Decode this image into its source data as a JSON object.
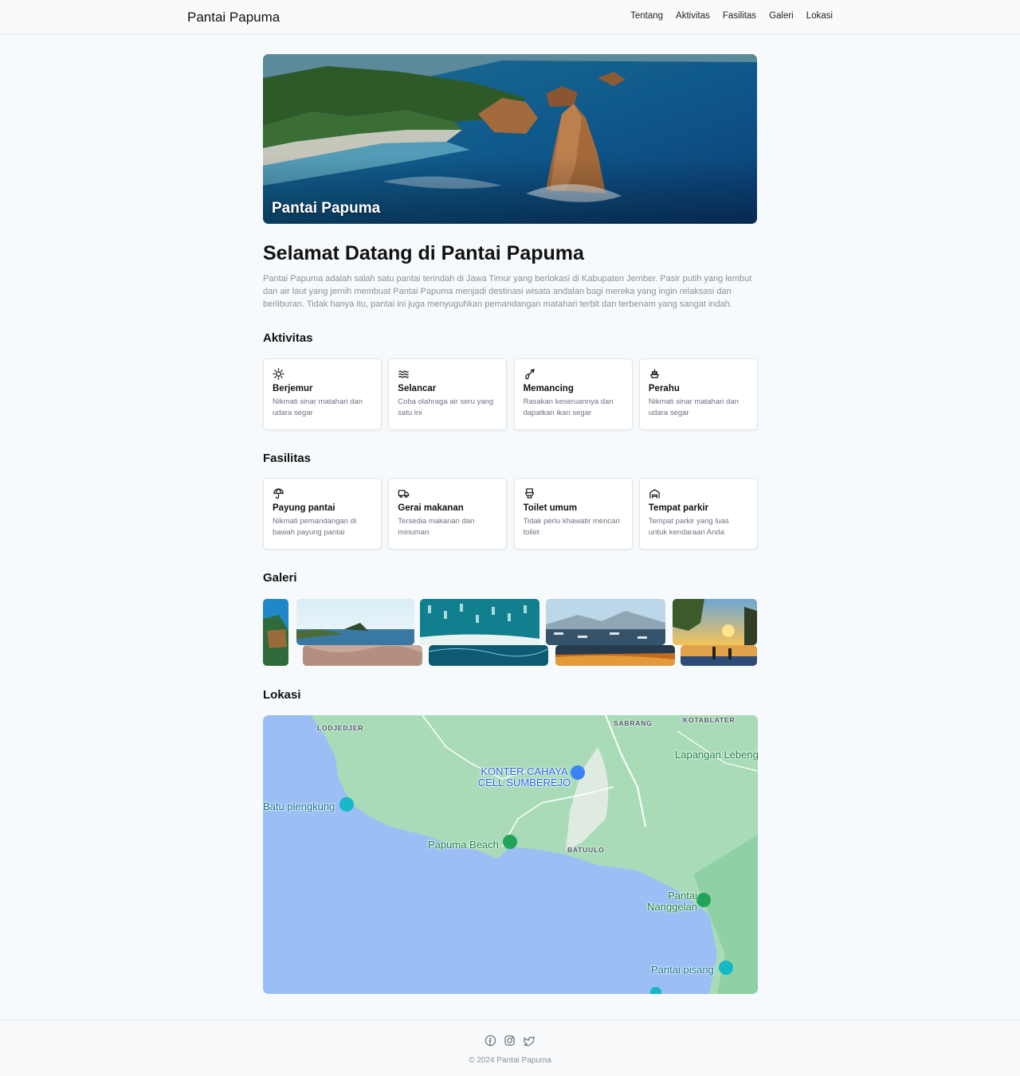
{
  "header": {
    "brand": "Pantai Papuma",
    "nav": [
      "Tentang",
      "Aktivitas",
      "Fasilitas",
      "Galeri",
      "Lokasi"
    ]
  },
  "hero": {
    "title": "Pantai Papuma"
  },
  "intro": {
    "heading": "Selamat Datang di Pantai Papuma",
    "text": "Pantai Papuma adalah salah satu pantai terindah di Jawa Timur yang berlokasi di Kabupaten Jember. Pasir putih yang lembut dan air laut yang jernih membuat Pantai Papuma menjadi destinasi wisata andalan bagi mereka yang ingin relaksasi dan berliburan. Tidak hanya itu, pantai ini juga menyuguhkan pemandangan matahari terbit dan terbenam yang sangat indah."
  },
  "aktivitas": {
    "title": "Aktivitas",
    "items": [
      {
        "icon": "sun-icon",
        "title": "Berjemur",
        "desc": "Nikmati sinar matahari dan udara segar"
      },
      {
        "icon": "waves-icon",
        "title": "Selancar",
        "desc": "Coba olahraga air seru yang satu ini"
      },
      {
        "icon": "fishing-icon",
        "title": "Memancing",
        "desc": "Rasakan keseruannya dan dapatkan ikan segar"
      },
      {
        "icon": "boat-icon",
        "title": "Perahu",
        "desc": "Nikmati sinar matahari dan udara segar"
      }
    ]
  },
  "fasilitas": {
    "title": "Fasilitas",
    "items": [
      {
        "icon": "umbrella-icon",
        "title": "Payung pantai",
        "desc": "Nikmati pemandangan di bawah payung pantai"
      },
      {
        "icon": "food-truck-icon",
        "title": "Gerai makanan",
        "desc": "Tersedia makanan dan minuman"
      },
      {
        "icon": "toilet-icon",
        "title": "Toilet umum",
        "desc": "Tidak perlu khawatir mencari toilet"
      },
      {
        "icon": "parking-icon",
        "title": "Tempat parkir",
        "desc": "Tempat parkir yang luas untuk kendaraan Anda"
      }
    ]
  },
  "galeri": {
    "title": "Galeri"
  },
  "lokasi": {
    "title": "Lokasi",
    "map": {
      "places": [
        "KONTER CAHAYA CELL SUMBEREJO",
        "Batu plengkung",
        "Papuma Beach",
        "Pantai Nanggelan",
        "Pantai pisang",
        "Lapangan Lebeng"
      ],
      "areas": [
        "LODJEDJER",
        "SABRANG",
        "KOTABLATER",
        "BATUULO"
      ]
    }
  },
  "footer": {
    "social": [
      "facebook-icon",
      "instagram-icon",
      "twitter-icon"
    ],
    "copyright": "© 2024 Pantai Papuma"
  }
}
